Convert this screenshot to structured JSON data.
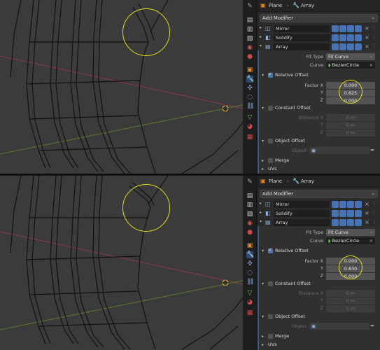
{
  "shots": [
    {
      "header": {
        "object_name": "Plane",
        "modifier_name": "Array"
      },
      "add_modifier_label": "Add Modifier",
      "modifiers": [
        {
          "name": "Mirror",
          "icon": "mirror-icon"
        },
        {
          "name": "Solidify",
          "icon": "solidify-icon"
        },
        {
          "name": "Array",
          "icon": "array-icon"
        }
      ],
      "array": {
        "fit_type_label": "Fit Type",
        "fit_type_value": "Fit Curve",
        "curve_label": "Curve",
        "curve_value": "BezierCircle",
        "relative_offset_label": "Relative Offset",
        "factor_x_label": "Factor X",
        "factor_y_label": "Y",
        "factor_z_label": "Z",
        "factor_x": "0.000",
        "factor_y": "0.825",
        "factor_z": "0.000",
        "constant_offset_label": "Constant Offset",
        "distance_x_label": "Distance X",
        "distance_y_label": "Y",
        "distance_z_label": "Z",
        "distance_x": "0 m",
        "distance_y": "0 m",
        "distance_z": "0 m",
        "object_offset_label": "Object Offset",
        "object_label": "Object",
        "merge_label": "Merge",
        "uvs_label": "UVs"
      }
    },
    {
      "header": {
        "object_name": "Plane",
        "modifier_name": "Array"
      },
      "add_modifier_label": "Add Modifier",
      "modifiers": [
        {
          "name": "Mirror",
          "icon": "mirror-icon"
        },
        {
          "name": "Solidify",
          "icon": "solidify-icon"
        },
        {
          "name": "Array",
          "icon": "array-icon"
        }
      ],
      "array": {
        "fit_type_label": "Fit Type",
        "fit_type_value": "Fit Curve",
        "curve_label": "Curve",
        "curve_value": "BezierCircle",
        "relative_offset_label": "Relative Offset",
        "factor_x_label": "Factor X",
        "factor_y_label": "Y",
        "factor_z_label": "Z",
        "factor_x": "0.000",
        "factor_y": "0.830",
        "factor_z": "0.000",
        "constant_offset_label": "Constant Offset",
        "distance_x_label": "Distance X",
        "distance_y_label": "Y",
        "distance_z_label": "Z",
        "distance_x": "0 m",
        "distance_y": "0 m",
        "distance_z": "0 m",
        "object_offset_label": "Object Offset",
        "object_label": "Object",
        "merge_label": "Merge",
        "uvs_label": "UVs"
      }
    }
  ],
  "colors": {
    "viewport_bg": "#3b3b3b",
    "panel_bg": "#2b2b2b",
    "accent_blue": "#4772b3",
    "highlight_circle": "#e6e01a",
    "x_axis": "#8c3a4a",
    "y_axis": "#5b7a2e"
  },
  "tool_icons": [
    "tool-icon",
    "render-icon",
    "output-icon",
    "view-layer-icon",
    "scene-icon",
    "world-icon",
    "object-icon",
    "modifier-icon",
    "particles-icon",
    "physics-icon",
    "constraints-icon",
    "data-icon",
    "material-icon",
    "texture-icon"
  ]
}
